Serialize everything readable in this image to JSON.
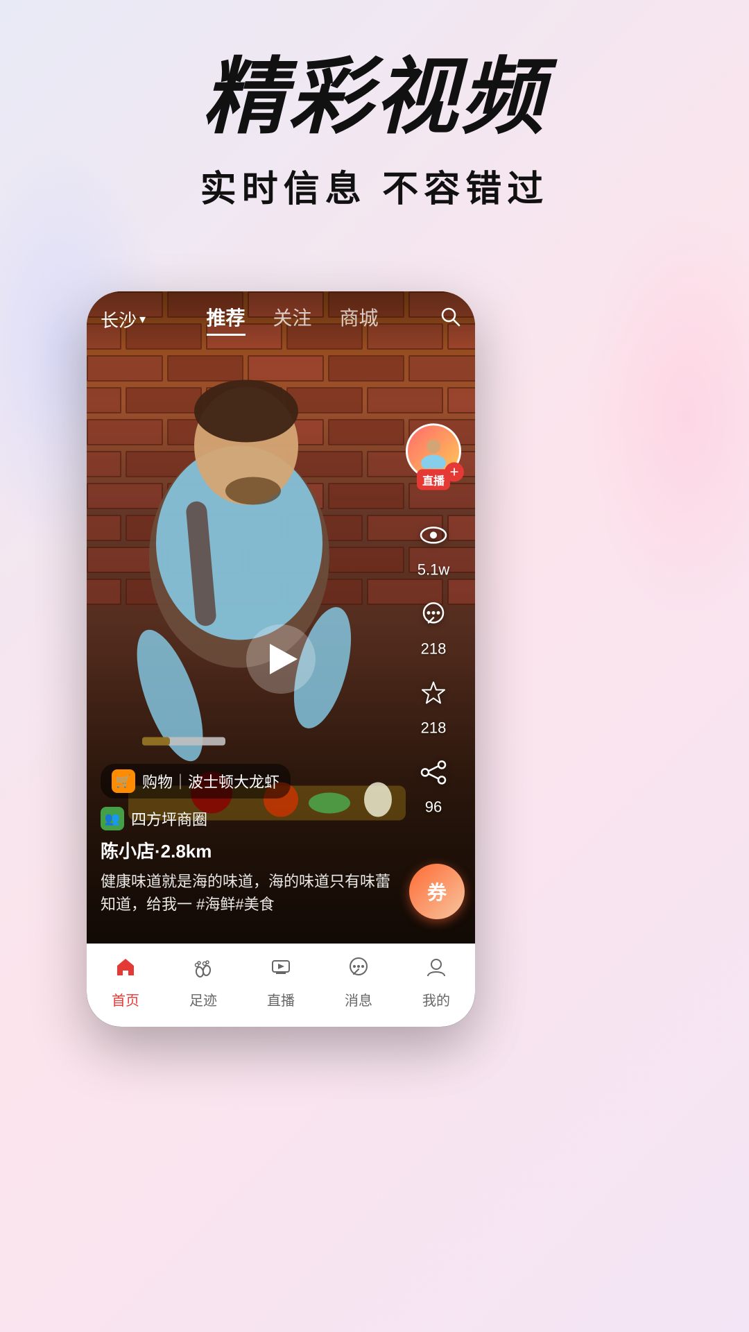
{
  "hero": {
    "title": "精彩视频",
    "subtitle": "实时信息  不容错过"
  },
  "video": {
    "location": "长沙",
    "nav_tabs": [
      {
        "label": "推荐",
        "active": true
      },
      {
        "label": "关注",
        "active": false
      },
      {
        "label": "商城",
        "active": false
      }
    ],
    "views_count": "5.1w",
    "comments_count": "218",
    "likes_count": "218",
    "shares_count": "96",
    "live_badge": "直播",
    "shopping_tag": "购物｜波士顿大龙虾",
    "community_tag": "四方坪商圈",
    "store_location": "陈小店·2.8km",
    "description": "健康味道就是海的味道，海的味道只有味蕾知道，给我一 #海鲜#美食",
    "coupon_text": "券"
  },
  "bottom_nav": {
    "items": [
      {
        "label": "首页",
        "active": true,
        "icon": "home"
      },
      {
        "label": "足迹",
        "active": false,
        "icon": "footprint"
      },
      {
        "label": "直播",
        "active": false,
        "icon": "live"
      },
      {
        "label": "消息",
        "active": false,
        "icon": "message"
      },
      {
        "label": "我的",
        "active": false,
        "icon": "profile"
      }
    ]
  }
}
